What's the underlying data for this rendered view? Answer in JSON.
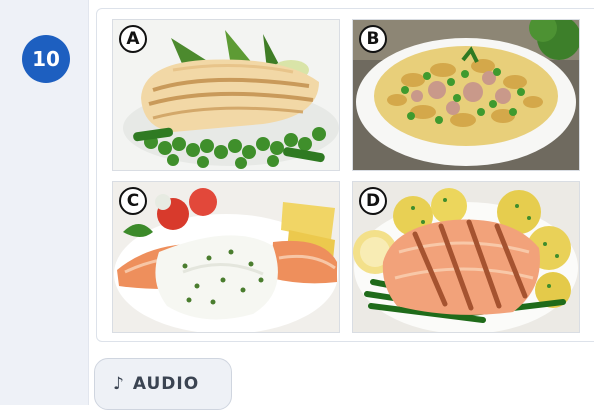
{
  "question": {
    "number": "10"
  },
  "options": [
    {
      "letter": "A",
      "image": "grilled-fish-with-peas"
    },
    {
      "letter": "B",
      "image": "tuna-pasta-salad"
    },
    {
      "letter": "C",
      "image": "salmon-with-creamy-sauce"
    },
    {
      "letter": "D",
      "image": "grilled-salmon-with-potatoes"
    }
  ],
  "audio_button": {
    "icon": "music-note-icon",
    "note_glyph": "♪",
    "label": "AUDIO"
  },
  "colors": {
    "accent": "#1d5fc0",
    "rail": "#eef1f7"
  }
}
